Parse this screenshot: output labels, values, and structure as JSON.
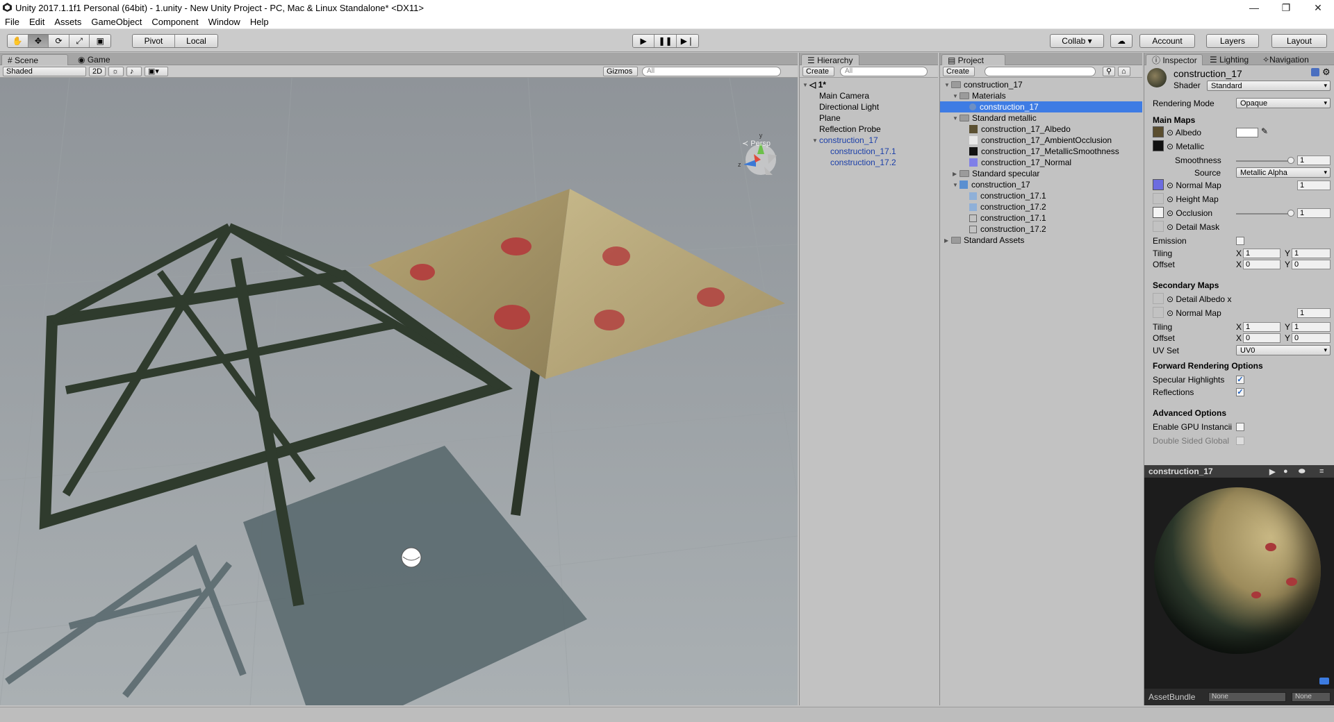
{
  "window": {
    "title": "Unity 2017.1.1f1 Personal (64bit) - 1.unity - New Unity Project - PC, Mac & Linux Standalone* <DX11>"
  },
  "menu": [
    "File",
    "Edit",
    "Assets",
    "GameObject",
    "Component",
    "Window",
    "Help"
  ],
  "toolbar": {
    "pivot": "Pivot",
    "local": "Local",
    "collab": "Collab ▾",
    "account": "Account",
    "layers": "Layers",
    "layout": "Layout"
  },
  "scene": {
    "tab_scene": "Scene",
    "tab_game": "Game",
    "shading": "Shaded",
    "mode2d": "2D",
    "gizmos": "Gizmos",
    "search_placeholder": "All",
    "persp": "≺ Persp"
  },
  "hierarchy": {
    "tab": "Hierarchy",
    "create": "Create",
    "search_placeholder": "All",
    "scene_name": "1*",
    "items": [
      "Main Camera",
      "Directional Light",
      "Plane",
      "Reflection Probe",
      "construction_17",
      "construction_17.1",
      "construction_17.2"
    ]
  },
  "project": {
    "tab": "Project",
    "create": "Create",
    "items": [
      "construction_17",
      "Materials",
      "construction_17",
      "Standard metallic",
      "construction_17_Albedo",
      "construction_17_AmbientOcclusion",
      "construction_17_MetallicSmoothness",
      "construction_17_Normal",
      "Standard specular",
      "construction_17",
      "construction_17.1",
      "construction_17.2",
      "construction_17.1",
      "construction_17.2",
      "Standard Assets"
    ]
  },
  "inspector": {
    "tab_inspector": "Inspector",
    "tab_lighting": "Lighting",
    "tab_navigation": "Navigation",
    "material_name": "construction_17",
    "shader_label": "Shader",
    "shader_value": "Standard",
    "rendering_mode_label": "Rendering Mode",
    "rendering_mode_value": "Opaque",
    "main_maps": "Main Maps",
    "albedo": "Albedo",
    "metallic": "Metallic",
    "smoothness": "Smoothness",
    "smoothness_value": "1",
    "source": "Source",
    "source_value": "Metallic Alpha",
    "normal_map": "Normal Map",
    "normal_value": "1",
    "height_map": "Height Map",
    "occlusion": "Occlusion",
    "occlusion_value": "1",
    "detail_mask": "Detail Mask",
    "emission": "Emission",
    "tiling": "Tiling",
    "offset": "Offset",
    "tiling_x": "1",
    "tiling_y": "1",
    "offset_x": "0",
    "offset_y": "0",
    "secondary_maps": "Secondary Maps",
    "detail_albedo": "Detail Albedo x",
    "sec_normal_map": "Normal Map",
    "sec_normal_value": "1",
    "sec_tiling_x": "1",
    "sec_tiling_y": "1",
    "sec_offset_x": "0",
    "sec_offset_y": "0",
    "uv_set": "UV Set",
    "uv_set_value": "UV0",
    "forward_options": "Forward Rendering Options",
    "specular_highlights": "Specular Highlights",
    "reflections": "Reflections",
    "advanced_options": "Advanced Options",
    "gpu_instancing": "Enable GPU Instancii",
    "double_sided": "Double Sided Global",
    "x": "X",
    "y": "Y"
  },
  "preview": {
    "title": "construction_17",
    "assetbundle": "AssetBundle",
    "none1": "None",
    "none2": "None"
  },
  "colors": {
    "selection": "#3e7ce4",
    "panel": "#c2c2c2",
    "tabstrip": "#a5a5a5",
    "hierarchy_blue": "#1a3ea8"
  }
}
